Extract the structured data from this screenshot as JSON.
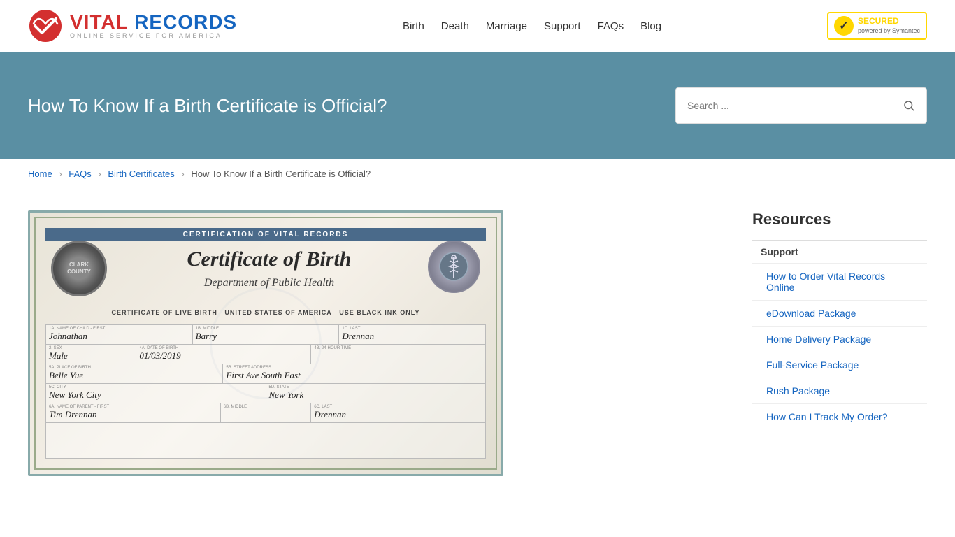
{
  "header": {
    "logo": {
      "vital": "VITAL",
      "records": "RECORDS",
      "tagline": "ONLINE SERVICE FOR AMERICA"
    },
    "nav": {
      "items": [
        "Birth",
        "Death",
        "Marriage",
        "Support",
        "FAQs",
        "Blog"
      ]
    },
    "norton": {
      "secured": "SECURED",
      "powered": "powered by Symantec"
    }
  },
  "hero": {
    "title": "How To Know If a Birth Certificate is Official?",
    "search": {
      "placeholder": "Search ..."
    }
  },
  "breadcrumb": {
    "home": "Home",
    "faqs": "FAQs",
    "birth_certs": "Birth Certificates",
    "current": "How To Know If a Birth Certificate is Official?"
  },
  "certificate": {
    "header_bar": "CERTIFICATION OF VITAL RECORDS",
    "main_title": "Certificate of Birth",
    "department": "Department of Public Health",
    "live_birth": "CERTIFICATE OF LIVE BIRTH",
    "country": "UNITED STATES OF AMERICA",
    "ink_note": "USE BLACK INK ONLY",
    "seal_left": "CLARK COUNTY",
    "fields": {
      "first_name": "Johnathan",
      "middle": "Barry",
      "last": "Drennan",
      "sex": "Male",
      "dob": "01/03/2019",
      "place": "Belle Vue",
      "street": "First Ave South East",
      "city": "New York City",
      "state": "New York"
    }
  },
  "sidebar": {
    "title": "Resources",
    "section": "Support",
    "items": [
      "How to Order Vital Records Online",
      "eDownload Package",
      "Home Delivery Package",
      "Full-Service Package",
      "Rush Package",
      "How Can I Track My Order?"
    ]
  }
}
